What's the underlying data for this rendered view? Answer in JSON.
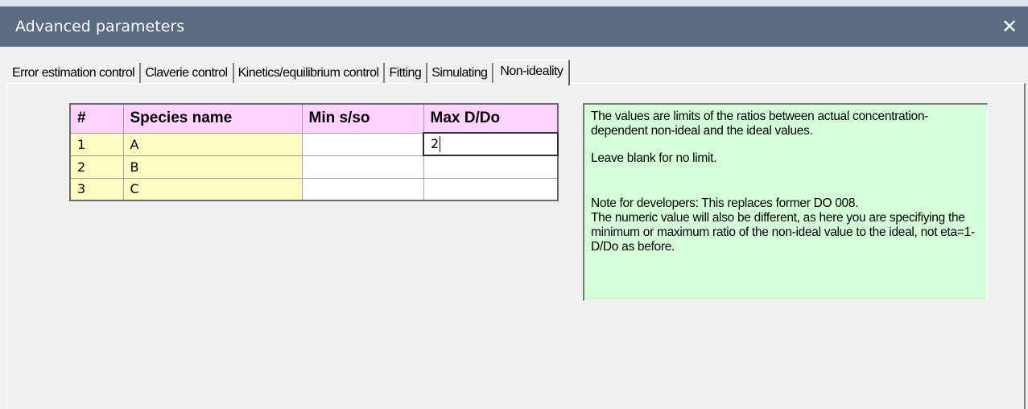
{
  "window": {
    "title": "Advanced parameters",
    "close_glyph": "✕"
  },
  "tabs": [
    {
      "label": "Error estimation control",
      "active": false
    },
    {
      "label": "Claverie control",
      "active": false
    },
    {
      "label": "Kinetics/equilibrium control",
      "active": false
    },
    {
      "label": "Fitting",
      "active": false
    },
    {
      "label": "Simulating",
      "active": false
    },
    {
      "label": "Non-ideality",
      "active": true
    }
  ],
  "grid": {
    "headers": [
      "#",
      "Species name",
      "Min s/so",
      "Max D/Do"
    ],
    "rows": [
      {
        "num": "1",
        "name": "A",
        "min_s_so": "",
        "max_d_do": "2"
      },
      {
        "num": "2",
        "name": "B",
        "min_s_so": "",
        "max_d_do": ""
      },
      {
        "num": "3",
        "name": "C",
        "min_s_so": "",
        "max_d_do": ""
      }
    ]
  },
  "note": {
    "para1": "The values are limits of the ratios between actual concentration-dependent non-ideal and the ideal values.",
    "para2": "Leave blank for no limit.",
    "para3_line1": "Note for developers: This replaces former DO 008.",
    "para3_line2": "The numeric value will also be different, as here you are specifiying the minimum or maximum ratio of the non-ideal value to the ideal, not eta=1-D/Do as before."
  },
  "colors": {
    "titlebar": "#5a6b82",
    "header_cells": "#ffd2ff",
    "name_cells": "#fdfdc2",
    "note_bg": "#d4ffd8"
  }
}
